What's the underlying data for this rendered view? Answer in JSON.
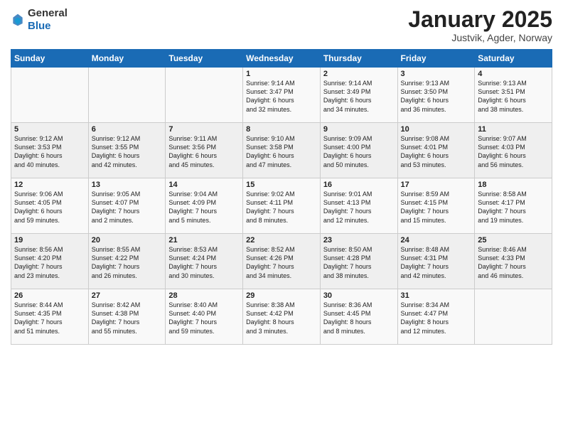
{
  "header": {
    "logo_general": "General",
    "logo_blue": "Blue",
    "title": "January 2025",
    "subtitle": "Justvik, Agder, Norway"
  },
  "days_of_week": [
    "Sunday",
    "Monday",
    "Tuesday",
    "Wednesday",
    "Thursday",
    "Friday",
    "Saturday"
  ],
  "weeks": [
    [
      {
        "day": "",
        "content": ""
      },
      {
        "day": "",
        "content": ""
      },
      {
        "day": "",
        "content": ""
      },
      {
        "day": "1",
        "content": "Sunrise: 9:14 AM\nSunset: 3:47 PM\nDaylight: 6 hours\nand 32 minutes."
      },
      {
        "day": "2",
        "content": "Sunrise: 9:14 AM\nSunset: 3:49 PM\nDaylight: 6 hours\nand 34 minutes."
      },
      {
        "day": "3",
        "content": "Sunrise: 9:13 AM\nSunset: 3:50 PM\nDaylight: 6 hours\nand 36 minutes."
      },
      {
        "day": "4",
        "content": "Sunrise: 9:13 AM\nSunset: 3:51 PM\nDaylight: 6 hours\nand 38 minutes."
      }
    ],
    [
      {
        "day": "5",
        "content": "Sunrise: 9:12 AM\nSunset: 3:53 PM\nDaylight: 6 hours\nand 40 minutes."
      },
      {
        "day": "6",
        "content": "Sunrise: 9:12 AM\nSunset: 3:55 PM\nDaylight: 6 hours\nand 42 minutes."
      },
      {
        "day": "7",
        "content": "Sunrise: 9:11 AM\nSunset: 3:56 PM\nDaylight: 6 hours\nand 45 minutes."
      },
      {
        "day": "8",
        "content": "Sunrise: 9:10 AM\nSunset: 3:58 PM\nDaylight: 6 hours\nand 47 minutes."
      },
      {
        "day": "9",
        "content": "Sunrise: 9:09 AM\nSunset: 4:00 PM\nDaylight: 6 hours\nand 50 minutes."
      },
      {
        "day": "10",
        "content": "Sunrise: 9:08 AM\nSunset: 4:01 PM\nDaylight: 6 hours\nand 53 minutes."
      },
      {
        "day": "11",
        "content": "Sunrise: 9:07 AM\nSunset: 4:03 PM\nDaylight: 6 hours\nand 56 minutes."
      }
    ],
    [
      {
        "day": "12",
        "content": "Sunrise: 9:06 AM\nSunset: 4:05 PM\nDaylight: 6 hours\nand 59 minutes."
      },
      {
        "day": "13",
        "content": "Sunrise: 9:05 AM\nSunset: 4:07 PM\nDaylight: 7 hours\nand 2 minutes."
      },
      {
        "day": "14",
        "content": "Sunrise: 9:04 AM\nSunset: 4:09 PM\nDaylight: 7 hours\nand 5 minutes."
      },
      {
        "day": "15",
        "content": "Sunrise: 9:02 AM\nSunset: 4:11 PM\nDaylight: 7 hours\nand 8 minutes."
      },
      {
        "day": "16",
        "content": "Sunrise: 9:01 AM\nSunset: 4:13 PM\nDaylight: 7 hours\nand 12 minutes."
      },
      {
        "day": "17",
        "content": "Sunrise: 8:59 AM\nSunset: 4:15 PM\nDaylight: 7 hours\nand 15 minutes."
      },
      {
        "day": "18",
        "content": "Sunrise: 8:58 AM\nSunset: 4:17 PM\nDaylight: 7 hours\nand 19 minutes."
      }
    ],
    [
      {
        "day": "19",
        "content": "Sunrise: 8:56 AM\nSunset: 4:20 PM\nDaylight: 7 hours\nand 23 minutes."
      },
      {
        "day": "20",
        "content": "Sunrise: 8:55 AM\nSunset: 4:22 PM\nDaylight: 7 hours\nand 26 minutes."
      },
      {
        "day": "21",
        "content": "Sunrise: 8:53 AM\nSunset: 4:24 PM\nDaylight: 7 hours\nand 30 minutes."
      },
      {
        "day": "22",
        "content": "Sunrise: 8:52 AM\nSunset: 4:26 PM\nDaylight: 7 hours\nand 34 minutes."
      },
      {
        "day": "23",
        "content": "Sunrise: 8:50 AM\nSunset: 4:28 PM\nDaylight: 7 hours\nand 38 minutes."
      },
      {
        "day": "24",
        "content": "Sunrise: 8:48 AM\nSunset: 4:31 PM\nDaylight: 7 hours\nand 42 minutes."
      },
      {
        "day": "25",
        "content": "Sunrise: 8:46 AM\nSunset: 4:33 PM\nDaylight: 7 hours\nand 46 minutes."
      }
    ],
    [
      {
        "day": "26",
        "content": "Sunrise: 8:44 AM\nSunset: 4:35 PM\nDaylight: 7 hours\nand 51 minutes."
      },
      {
        "day": "27",
        "content": "Sunrise: 8:42 AM\nSunset: 4:38 PM\nDaylight: 7 hours\nand 55 minutes."
      },
      {
        "day": "28",
        "content": "Sunrise: 8:40 AM\nSunset: 4:40 PM\nDaylight: 7 hours\nand 59 minutes."
      },
      {
        "day": "29",
        "content": "Sunrise: 8:38 AM\nSunset: 4:42 PM\nDaylight: 8 hours\nand 3 minutes."
      },
      {
        "day": "30",
        "content": "Sunrise: 8:36 AM\nSunset: 4:45 PM\nDaylight: 8 hours\nand 8 minutes."
      },
      {
        "day": "31",
        "content": "Sunrise: 8:34 AM\nSunset: 4:47 PM\nDaylight: 8 hours\nand 12 minutes."
      },
      {
        "day": "",
        "content": ""
      }
    ]
  ]
}
